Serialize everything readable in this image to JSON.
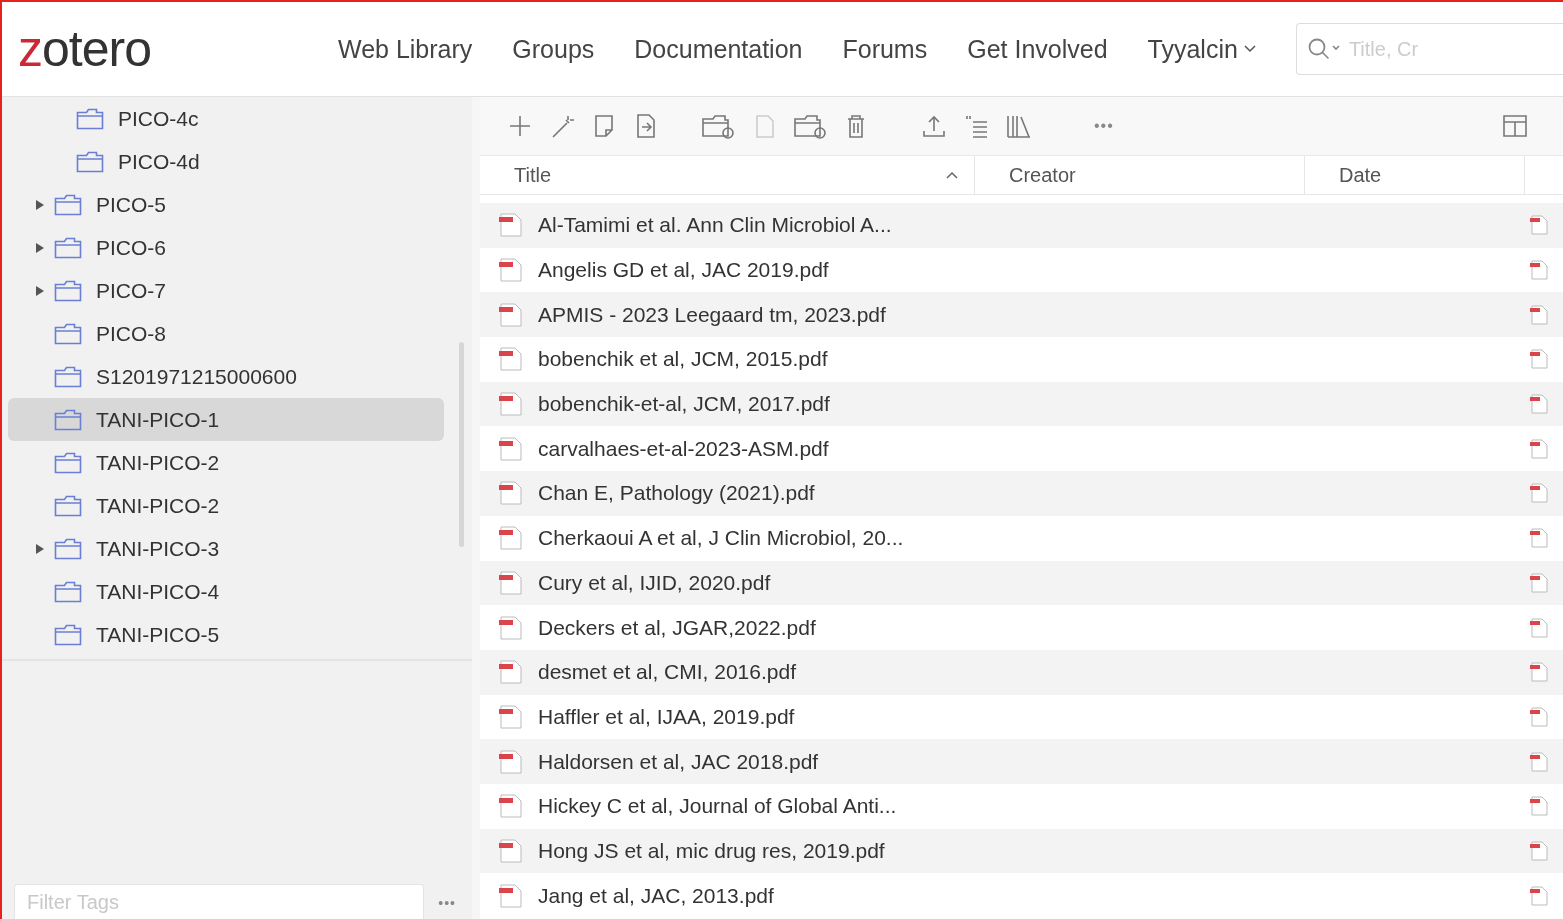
{
  "header": {
    "logo": "zotero",
    "nav": [
      {
        "label": "Web Library"
      },
      {
        "label": "Groups"
      },
      {
        "label": "Documentation"
      },
      {
        "label": "Forums"
      },
      {
        "label": "Get Involved"
      }
    ],
    "user": "Tyyalcin",
    "search": {
      "placeholder": "Title, Cr"
    }
  },
  "collections": [
    {
      "children": [
        {
          "label": "PICO-4c",
          "has_children": false,
          "selected": false
        },
        {
          "label": "PICO-4d",
          "has_children": false,
          "selected": false
        }
      ]
    },
    {
      "label": "PICO-5",
      "has_children": true,
      "selected": false
    },
    {
      "label": "PICO-6",
      "has_children": true,
      "selected": false
    },
    {
      "label": "PICO-7",
      "has_children": true,
      "selected": false
    },
    {
      "label": "PICO-8",
      "has_children": false,
      "selected": false
    },
    {
      "label": "S1201971215000600",
      "has_children": false,
      "selected": false
    },
    {
      "label": "TANI-PICO-1",
      "has_children": false,
      "selected": true
    },
    {
      "label": "TANI-PICO-2",
      "has_children": false,
      "selected": false
    },
    {
      "label": "TANI-PICO-2",
      "has_children": false,
      "selected": false
    },
    {
      "label": "TANI-PICO-3",
      "has_children": true,
      "selected": false
    },
    {
      "label": "TANI-PICO-4",
      "has_children": false,
      "selected": false
    },
    {
      "label": "TANI-PICO-5",
      "has_children": false,
      "selected": false
    }
  ],
  "tag_filter": {
    "placeholder": "Filter Tags",
    "more": "•••"
  },
  "toolbar": {
    "more": "•••"
  },
  "table": {
    "columns": [
      {
        "label": "Title",
        "sorted": true
      },
      {
        "label": "Creator",
        "sorted": false
      },
      {
        "label": "Date",
        "sorted": false
      }
    ],
    "rows": [
      {
        "title": "Al-Tamimi et al. Ann Clin Microbiol A..."
      },
      {
        "title": "Angelis GD et al, JAC 2019.pdf"
      },
      {
        "title": "APMIS - 2023 Leegaard tm, 2023.pdf"
      },
      {
        "title": "bobenchik et al, JCM, 2015.pdf"
      },
      {
        "title": "bobenchik-et-al, JCM, 2017.pdf"
      },
      {
        "title": "carvalhaes-et-al-2023-ASM.pdf"
      },
      {
        "title": "Chan E, Pathology (2021).pdf"
      },
      {
        "title": "Cherkaoui A et al, J Clin Microbiol, 20..."
      },
      {
        "title": "Cury et al, IJID, 2020.pdf"
      },
      {
        "title": "Deckers et al, JGAR,2022.pdf"
      },
      {
        "title": "desmet et al, CMI, 2016.pdf"
      },
      {
        "title": "Haffler et al, IJAA, 2019.pdf"
      },
      {
        "title": "Haldorsen et al, JAC 2018.pdf"
      },
      {
        "title": "Hickey C et al, Journal of Global Anti..."
      },
      {
        "title": "Hong JS et al, mic drug res, 2019.pdf"
      },
      {
        "title": "Jang et al, JAC, 2013.pdf"
      }
    ]
  }
}
